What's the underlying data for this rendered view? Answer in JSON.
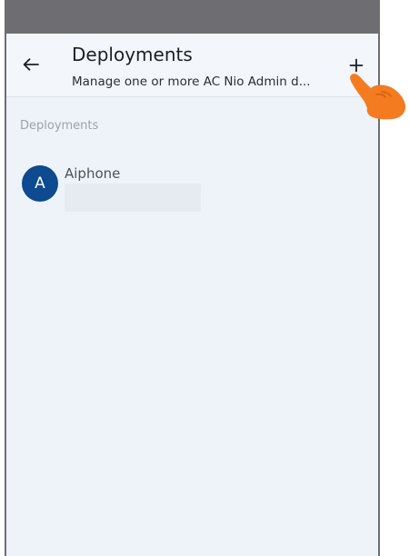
{
  "header": {
    "title": "Deployments",
    "subtitle": "Manage one or more AC Nio Admin d...",
    "back_icon": "arrow-left-icon",
    "add_icon": "plus-icon"
  },
  "section": {
    "label": "Deployments"
  },
  "deployments": [
    {
      "initial": "A",
      "name": "Aiphone",
      "secondary": ""
    }
  ],
  "colors": {
    "status_bar": "#6e6e72",
    "background": "#eef3fa",
    "avatar": "#0d4a8f",
    "pointer_hand": "#f47b20"
  }
}
